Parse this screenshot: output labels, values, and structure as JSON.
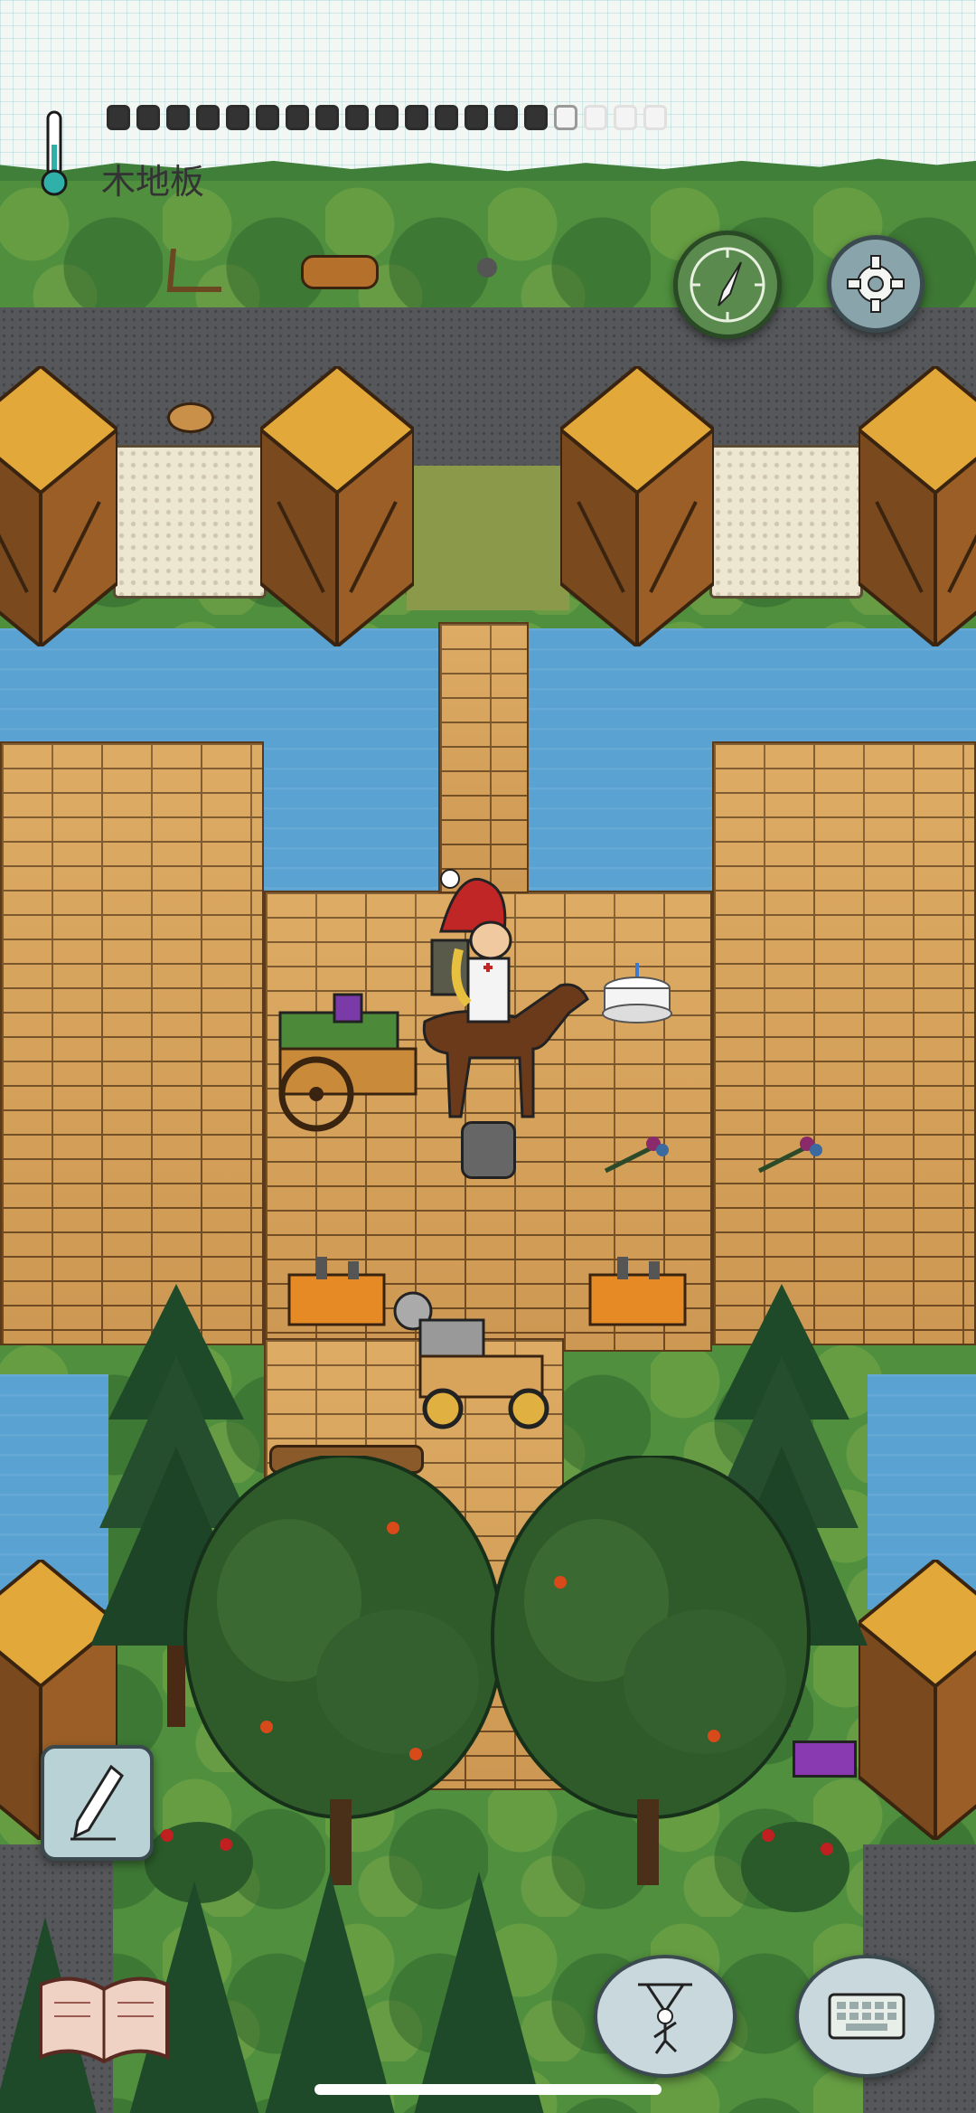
{
  "hud": {
    "location_label": "木地板",
    "thermometer_icon": "thermometer-icon",
    "hunger_pips": {
      "total": 19,
      "full": 15
    }
  },
  "buttons": {
    "compass_icon": "compass-icon",
    "settings_icon": "gear-icon",
    "note_icon": "pencil-note-icon",
    "tech_tree_icon": "book-icon",
    "emote_icon": "puppet-emote-icon",
    "chat_icon": "keyboard-chat-icon"
  },
  "colors": {
    "grass": "#4f8f3e",
    "water": "#5aa2d2",
    "floor": "#d8a35b",
    "hud_paper": "#f3f7f4",
    "button_fill": "#c9d8dc"
  }
}
